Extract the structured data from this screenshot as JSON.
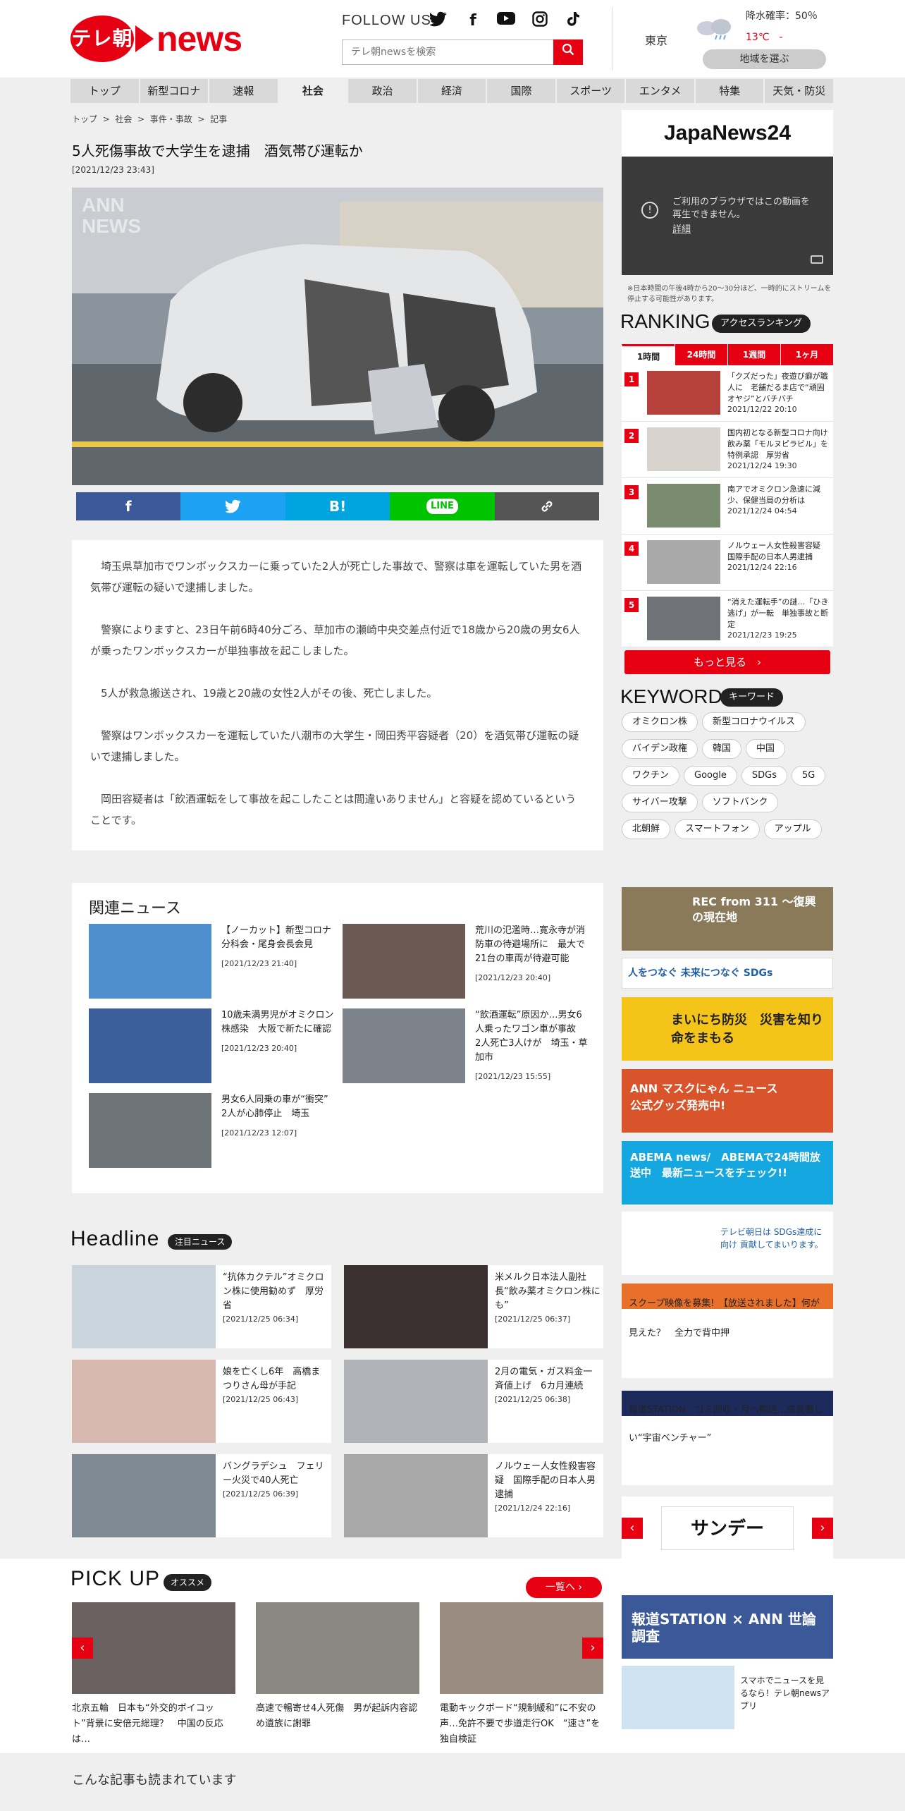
{
  "header": {
    "logo_mark": "テレ朝",
    "logo_word": "news",
    "follow_us": "FOLLOW US",
    "social": [
      "twitter-icon",
      "facebook-icon",
      "youtube-icon",
      "instagram-icon",
      "tiktok-icon"
    ],
    "search_placeholder": "テレ朝newsを検索",
    "city": "東京",
    "rain": "降水確率：50％",
    "temp": "13℃　-",
    "region_button": "地域を選ぶ"
  },
  "nav": [
    "トップ",
    "新型コロナ",
    "速報",
    "社会",
    "政治",
    "経済",
    "国際",
    "スポーツ",
    "エンタメ",
    "特集",
    "天気・防災"
  ],
  "breadcrumb": [
    "トップ",
    "社会",
    "事件・事故",
    "記事"
  ],
  "article": {
    "title": "5人死傷事故で大学生を逮捕　酒気帯び運転か",
    "date": "[2021/12/23 23:43]",
    "photo_watermark": "ANN NEWS",
    "paragraphs": [
      "埼玉県草加市でワンボックスカーに乗っていた2人が死亡した事故で、警察は車を運転していた男を酒気帯び運転の疑いで逮捕しました。",
      "警察によりますと、23日午前6時40分ごろ、草加市の瀬崎中央交差点付近で18歳から20歳の男女6人が乗ったワンボックスカーが単独事故を起こしました。",
      "5人が救急搬送され、19歳と20歳の女性2人がその後、死亡しました。",
      "警察はワンボックスカーを運転していた八潮市の大学生・岡田秀平容疑者（20）を酒気帯び運転の疑いで逮捕しました。",
      "岡田容疑者は「飲酒運転をして事故を起こしたことは間違いありません」と容疑を認めているということです。"
    ]
  },
  "share": [
    {
      "label": "f",
      "color": "#3b5998"
    },
    {
      "label": "🐦",
      "color": "#1da1f2"
    },
    {
      "label": "B!",
      "color": "#00a4de"
    },
    {
      "label": "LINE",
      "color": "#00c300"
    },
    {
      "label": "🔗",
      "color": "#555555"
    }
  ],
  "related": {
    "title": "関連ニュース",
    "items": [
      {
        "text": "【ノーカット】新型コロナ分科会・尾身会長会見",
        "date": "[2021/12/23 21:40]"
      },
      {
        "text": "荒川の氾濫時…寛永寺が消防車の待避場所に　最大で21台の車両が待避可能",
        "date": "[2021/12/23 20:40]"
      },
      {
        "text": "10歳未満男児がオミクロン株感染　大阪で新たに確認",
        "date": "[2021/12/23 20:40]"
      },
      {
        "text": "“飲酒運転”原因か…男女6人乗ったワゴン車が事故　2人死亡3人けが　埼玉・草加市",
        "date": "[2021/12/23 15:55]"
      },
      {
        "text": "男女6人同乗の車が“衝突”　2人が心肺停止　埼玉",
        "date": "[2021/12/23 12:07]"
      }
    ]
  },
  "headline": {
    "title": "Headline",
    "badge": "注目ニュース",
    "items": [
      {
        "text": "“抗体カクテル”オミクロン株に使用勧めず　厚労省",
        "date": "[2021/12/25 06:34]"
      },
      {
        "text": "米メルク日本法人副社長“飲み薬オミクロン株にも”",
        "date": "[2021/12/25 06:37]"
      },
      {
        "text": "娘を亡くし6年　高橋まつりさん母が手記",
        "date": "[2021/12/25 06:43]"
      },
      {
        "text": "2月の電気・ガス料金一斉値上げ　6カ月連続",
        "date": "[2021/12/25 06:38]"
      },
      {
        "text": "バングラデシュ　フェリー火災で40人死亡",
        "date": "[2021/12/25 06:39]"
      },
      {
        "text": "ノルウェー人女性殺害容疑　国際手配の日本人男逮捕",
        "date": "[2021/12/24 22:16]"
      }
    ]
  },
  "pickup": {
    "title": "PICK UP",
    "badge": "オススメ",
    "more": "一覧へ ›",
    "items": [
      {
        "text": "北京五輪　日本も“外交的ボイコット”背景に安倍元総理？　中国の反応は…"
      },
      {
        "text": "高速で暢寄せ4人死傷　男が起訴内容認め遺族に謝罪"
      },
      {
        "text": "電動キックボード“規制緩和”に不安の声…免許不要で歩道走行OK　“速さ”を独自検証"
      }
    ]
  },
  "bottom_title": "こんな記事も読まれています",
  "sidebar": {
    "japanews": "JapaNews24",
    "video_error": "ご利用のブラウザではこの動画を再生できません。",
    "video_detail": "詳細",
    "note": "※日本時間の午後4時から20～30分ほど、一時的にストリームを停止する可能性があります。",
    "ranking_title": "RANKING",
    "ranking_badge": "アクセスランキング",
    "ranking_tabs": [
      "1時間",
      "24時間",
      "1週間",
      "1ヶ月"
    ],
    "ranking": [
      {
        "n": "1",
        "text": "「クズだった」夜遊び癖が職人に　老舗だるま店で“頑固オヤジ”とバチバチ",
        "date": "2021/12/22 20:10"
      },
      {
        "n": "2",
        "text": "国内初となる新型コロナ向け飲み薬「モルヌピラビル」を特例承認　厚労省",
        "date": "2021/12/24 19:30"
      },
      {
        "n": "3",
        "text": "南アでオミクロン急速に減少、保健当局の分析は",
        "date": "2021/12/24 04:54"
      },
      {
        "n": "4",
        "text": "ノルウェー人女性殺害容疑　国際手配の日本人男逮捕",
        "date": "2021/12/24 22:16"
      },
      {
        "n": "5",
        "text": "“消えた運転手”の謎…「ひき逃げ」が一転　単独事故と断定",
        "date": "2021/12/23 19:25"
      }
    ],
    "ranking_more": "もっと見る　›",
    "keyword_title": "KEYWORD",
    "keyword_badge": "キーワード",
    "keywords": [
      "オミクロン株",
      "新型コロナウイルス",
      "バイデン政権",
      "韓国",
      "中国",
      "ワクチン",
      "Google",
      "SDGs",
      "5G",
      "サイバー攻撃",
      "ソフトバンク",
      "北朝鮮",
      "スマートフォン",
      "アップル"
    ],
    "banners": [
      {
        "text": "REC from 311 ～復興の現在地"
      },
      {
        "text": "人をつなぐ 未来につなぐ SDGs"
      },
      {
        "text": "まいにち防災　災害を知り 命をまもる"
      },
      {
        "text": "ANN マスクにゃん ニュース　公式グッズ発売中!"
      },
      {
        "text": "ABEMA news/　ABEMAで24時間放送中　最新ニュースをチェック!!"
      },
      {
        "text": "テレビ朝日は SDGs達成に向け 貢献してまいります。"
      },
      {
        "text": "スクープ映像を募集!　【放送されました】何が見えた？　全力で背中押"
      },
      {
        "text": "報道STATION　ゴミ回収・月へ輸送…成長著しい“宇宙ベンチャー”"
      },
      {
        "text": "サンデーLIVE!!"
      },
      {
        "text": "報道STATION × ANN 世論調査"
      },
      {
        "text": "スマホでニュースを見るなら！テレ朝newsアプリ"
      }
    ]
  }
}
